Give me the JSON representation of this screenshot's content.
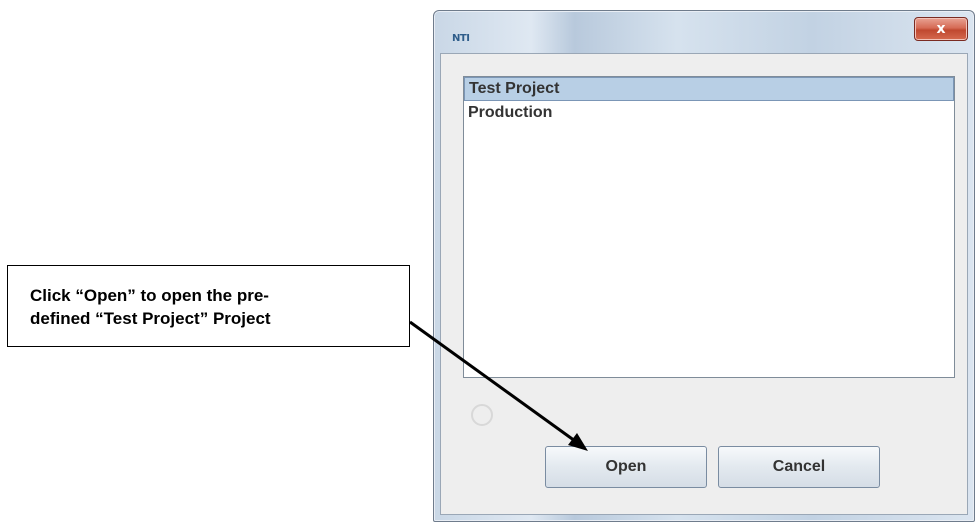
{
  "window": {
    "app_icon_text": "NTI",
    "close_glyph": "x",
    "projects": [
      "Test Project",
      "Production"
    ],
    "selected_index": 0,
    "open_label": "Open",
    "cancel_label": "Cancel"
  },
  "callout": {
    "line1": "Click “Open” to open the pre-",
    "line2": "defined “Test Project” Project"
  }
}
